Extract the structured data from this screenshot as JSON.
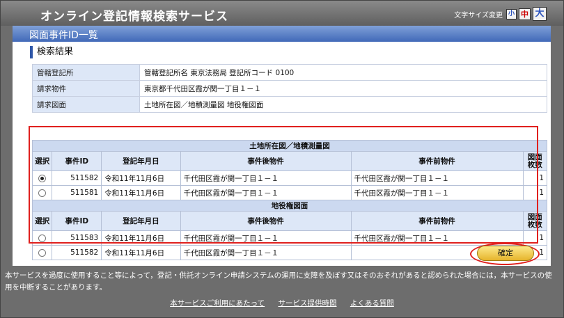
{
  "app": {
    "title": "オンライン登記情報検索サービス"
  },
  "font_size": {
    "label": "文字サイズ変更",
    "small": "小",
    "medium": "中",
    "large": "大"
  },
  "section": {
    "title": "図面事件ID一覧"
  },
  "results_heading": "検索結果",
  "info": [
    {
      "label": "管轄登記所",
      "value": "管轄登記所名  東京法務局  登記所コード 0100"
    },
    {
      "label": "請求物件",
      "value": "東京都千代田区霞が関一丁目１－１"
    },
    {
      "label": "請求図面",
      "value": "土地所在図／地積測量図  地役権図面"
    }
  ],
  "columns": {
    "select": "選択",
    "case_id": "事件ID",
    "date": "登記年月日",
    "after": "事件後物件",
    "before": "事件前物件",
    "count": "図面\n枚数"
  },
  "groups": [
    {
      "title": "土地所在図／地積測量図",
      "rows": [
        {
          "selected": true,
          "case_id": "511582",
          "date": "令和11年11月6日",
          "after": "千代田区霞が関一丁目１－１",
          "before": "千代田区霞が関一丁目１－１",
          "count": "1"
        },
        {
          "selected": false,
          "case_id": "511581",
          "date": "令和11年11月6日",
          "after": "千代田区霞が関一丁目１－１",
          "before": "千代田区霞が関一丁目１－１",
          "count": "1"
        }
      ]
    },
    {
      "title": "地役権図面",
      "rows": [
        {
          "selected": false,
          "case_id": "511583",
          "date": "令和11年11月6日",
          "after": "千代田区霞が関一丁目１－１",
          "before": "千代田区霞が関一丁目１－１",
          "count": "1"
        },
        {
          "selected": false,
          "case_id": "511582",
          "date": "令和11年11月6日",
          "after": "千代田区霞が関一丁目１－１",
          "before": "",
          "count": "1"
        }
      ]
    }
  ],
  "confirm_label": "確定",
  "notice": "本サービスを過度に使用すること等によって，登記・供託オンライン申請システムの運用に支障を及ぼす又はそのおそれがあると認められた場合には，本サービスの使用を中断することがあります。",
  "footer": {
    "link1": "本サービスご利用にあたって",
    "link2": "サービス提供時間",
    "link3": "よくある質問"
  }
}
